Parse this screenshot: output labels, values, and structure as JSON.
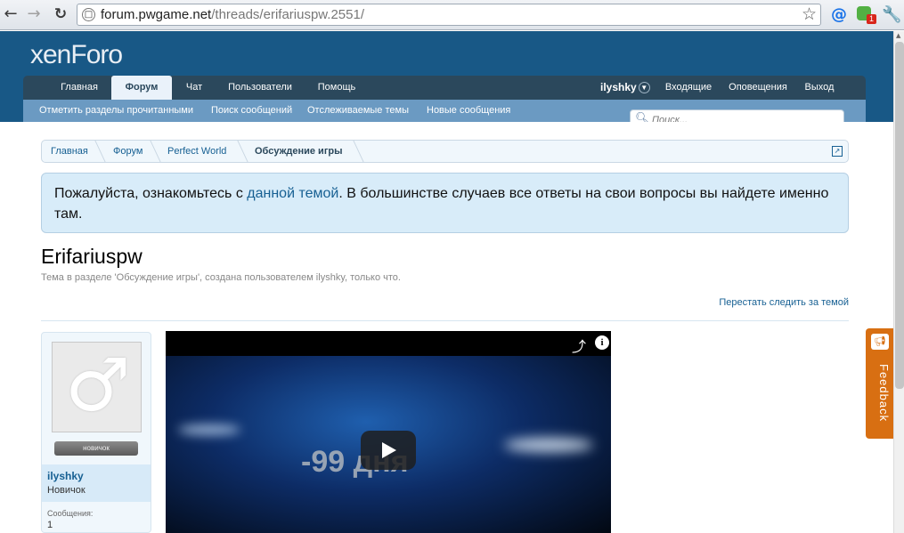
{
  "browser": {
    "url_domain": "forum.pwgame.net",
    "url_path": "/threads/erifariuspw.2551/",
    "chat_badge": "1"
  },
  "logo": {
    "main": "xenForo"
  },
  "nav": {
    "tabs": [
      "Главная",
      "Форум",
      "Чат",
      "Пользователи",
      "Помощь"
    ],
    "active_tab": "Форум",
    "username": "ilyshky",
    "right_links": [
      "Входящие",
      "Оповещения",
      "Выход"
    ]
  },
  "subnav": {
    "links": [
      "Отметить разделы прочитанными",
      "Поиск сообщений",
      "Отслеживаемые темы",
      "Новые сообщения"
    ]
  },
  "search": {
    "placeholder": "Поиск..."
  },
  "breadcrumb": {
    "items": [
      "Главная",
      "Форум",
      "Perfect World",
      "Обсуждение игры"
    ]
  },
  "notice": {
    "text_before": "Пожалуйста, ознакомьтесь с ",
    "link_text": "данной темой",
    "text_after": ". В большинстве случаев все ответы на свои вопросы вы найдете именно там."
  },
  "thread": {
    "title": "Erifariuspw",
    "subtitle": "Тема в разделе 'Обсуждение игры', создана пользователем ilyshky, только что.",
    "unwatch_link": "Перестать следить за темой"
  },
  "post": {
    "username": "ilyshky",
    "user_title": "Новичок",
    "rank_label": "новичок",
    "messages_label": "Сообщения:",
    "messages_count": "1"
  },
  "video": {
    "overlay_text": "-99 дня"
  },
  "feedback": {
    "label": "Feedback"
  }
}
